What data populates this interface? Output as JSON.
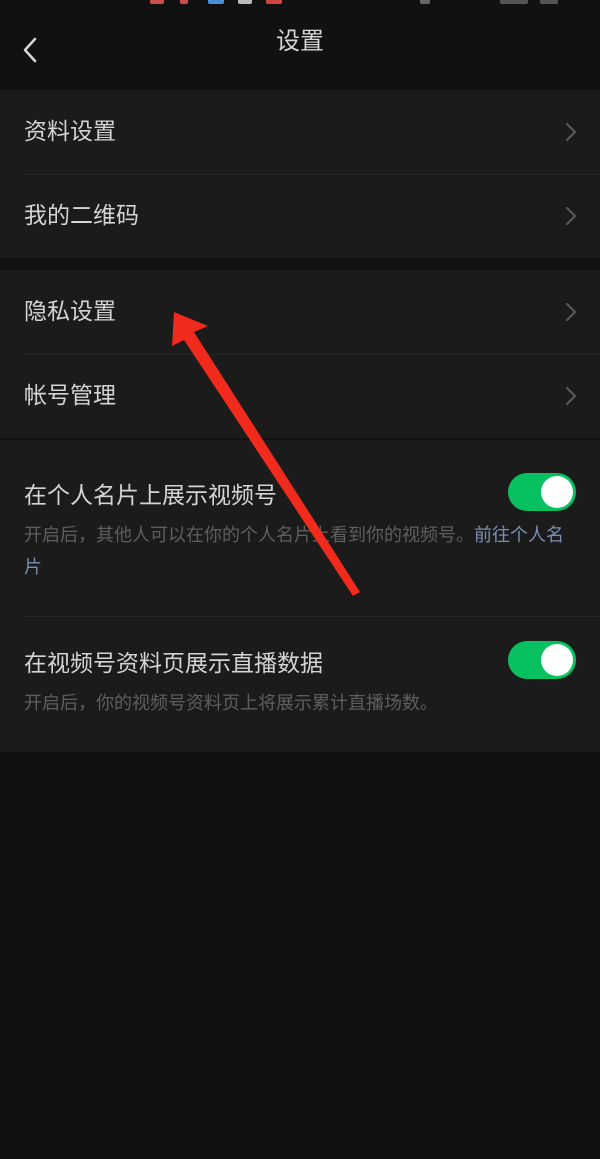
{
  "header": {
    "title": "设置",
    "back_icon": "chevron-left-icon"
  },
  "group1": {
    "items": [
      {
        "label": "资料设置"
      },
      {
        "label": "我的二维码"
      }
    ]
  },
  "group2": {
    "items": [
      {
        "label": "隐私设置"
      },
      {
        "label": "帐号管理"
      }
    ]
  },
  "toggles": [
    {
      "title": "在个人名片上展示视频号",
      "description": "开启后，其他人可以在你的个人名片上看到你的视频号。",
      "link_text": "前往个人名片",
      "enabled": true
    },
    {
      "title": "在视频号资料页展示直播数据",
      "description": "开启后，你的视频号资料页上将展示累计直播场数。",
      "enabled": true
    }
  ],
  "colors": {
    "background": "#111111",
    "card": "#1b1b1b",
    "accent_green": "#07c160",
    "link": "#7b8fb5",
    "annotation_arrow": "#f02a1c"
  }
}
